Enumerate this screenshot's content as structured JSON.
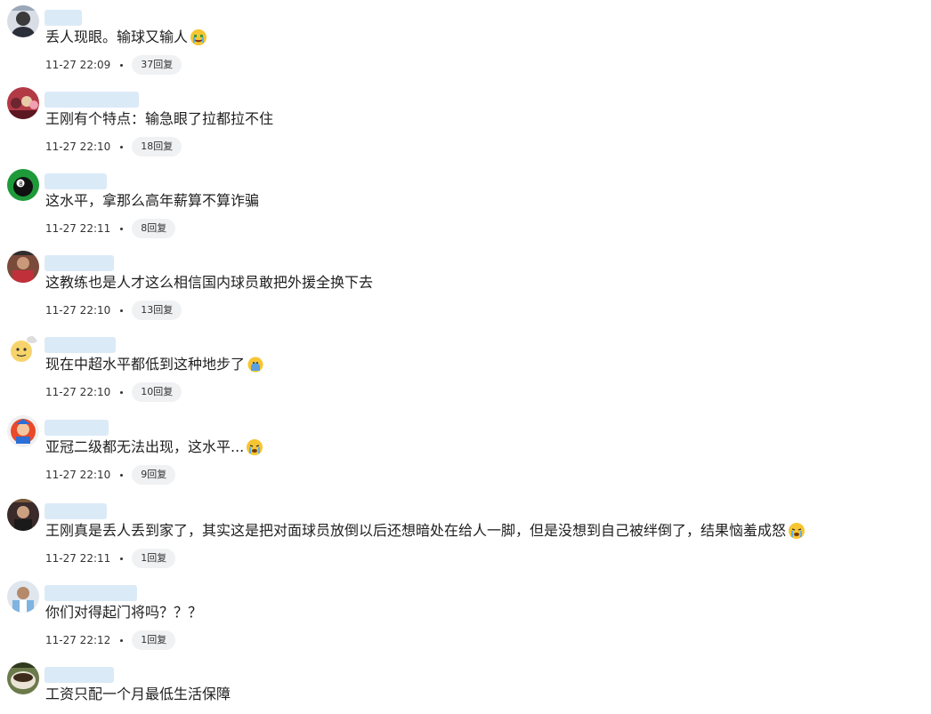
{
  "comments": [
    {
      "text": "丢人现眼。输球又输人",
      "emoji": "crying-money-face",
      "time": "11-27 22:09",
      "replies": "37回复"
    },
    {
      "text": "王刚有个特点：输急眼了拉都拉不住",
      "emoji": "",
      "time": "11-27 22:10",
      "replies": "18回复"
    },
    {
      "text": "这水平，拿那么高年薪算不算诈骗",
      "emoji": "",
      "time": "11-27 22:11",
      "replies": "8回复"
    },
    {
      "text": "这教练也是人才这么相信国内球员敢把外援全换下去",
      "emoji": "",
      "time": "11-27 22:10",
      "replies": "13回复"
    },
    {
      "text": "现在中超水平都低到这种地步了",
      "emoji": "face-palm-blue",
      "time": "11-27 22:10",
      "replies": "10回复"
    },
    {
      "text": "亚冠二级都无法出现，这水平...",
      "emoji": "crying-face",
      "time": "11-27 22:10",
      "replies": "9回复"
    },
    {
      "text": "王刚真是丢人丢到家了，其实这是把对面球员放倒以后还想暗处在给人一脚，但是没想到自己被绊倒了，结果恼羞成怒",
      "emoji": "crying-face",
      "time": "11-27 22:11",
      "replies": "1回复"
    },
    {
      "text": "你们对得起门将吗？？？",
      "emoji": "",
      "time": "11-27 22:12",
      "replies": "1回复"
    },
    {
      "text": "工资只配一个月最低生活保障",
      "emoji": "",
      "time": "",
      "replies": ""
    }
  ],
  "colors": {
    "username_blur": "#dbeaf7",
    "reply_bg": "#f0f1f3",
    "text": "#1f1f1f"
  }
}
